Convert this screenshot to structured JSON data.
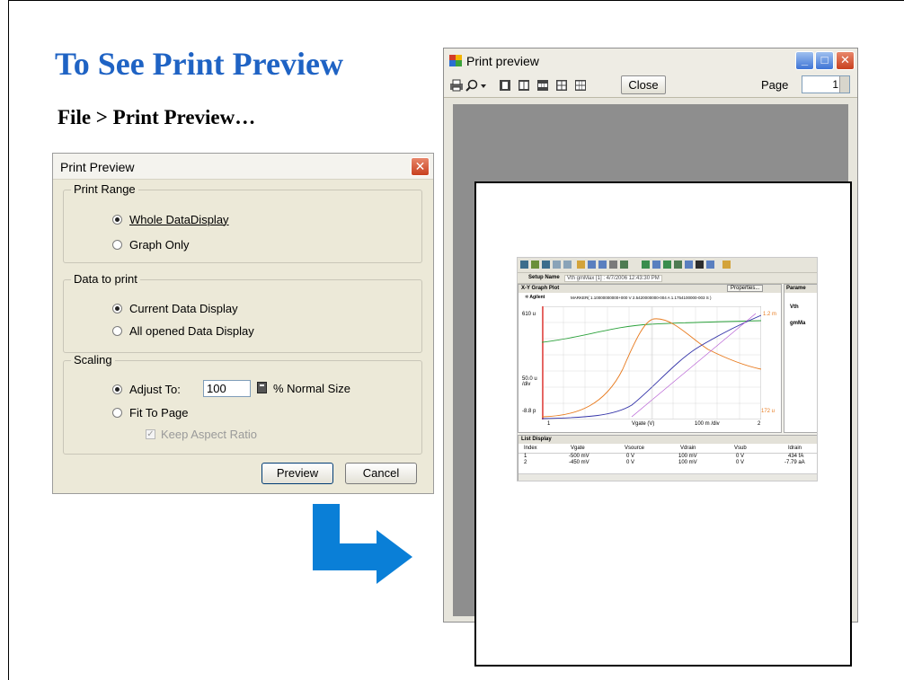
{
  "slide": {
    "title": "To See Print Preview",
    "subtitle": "File > Print Preview…"
  },
  "dialog": {
    "title": "Print Preview",
    "print_range": {
      "legend": "Print Range",
      "options": [
        "Whole DataDisplay",
        "Graph Only"
      ],
      "selected": "Whole DataDisplay"
    },
    "data_to_print": {
      "legend": "Data to print",
      "options": [
        "Current Data Display",
        "All opened Data Display"
      ],
      "selected": "Current Data Display"
    },
    "scaling": {
      "legend": "Scaling",
      "adjust_label": "Adjust To:",
      "adjust_value": "100",
      "percent_label": "% Normal Size",
      "fit_label": "Fit To Page",
      "keep_aspect_label": "Keep Aspect Ratio",
      "selected": "Adjust To:"
    },
    "preview_button": "Preview",
    "cancel_button": "Cancel"
  },
  "preview_window": {
    "title": "Print preview",
    "close_label": "Close",
    "page_label": "Page",
    "page_value": "1",
    "embedded": {
      "setup_tab": "Setup Name",
      "setup_value": "Vth gmMax [1] : 4/7/2006 12:43:30 PM",
      "graph_title": "X-Y Graph Plot",
      "properties_btn": "Properties...",
      "param_title": "Parame",
      "param_vth": "Vth",
      "param_gm": "gmMa",
      "marker_text": "MARKER( 1.10000000000+000 V  2.5420000000-004 A  1.1754100000-003 S )",
      "x_axis_label": "Vgate  (V)",
      "x_div": "100 m /div",
      "x_start": "1",
      "x_end": "2",
      "y_top": "610 u",
      "y_mid": "50.0 u\n/div",
      "y_bottom": "-8.8 p",
      "y2_top": "1.2 m",
      "y2_bottom": "-172 u",
      "list_title": "List Display",
      "list_headers": [
        "Index",
        "Vgate",
        "Vsource",
        "Vdrain",
        "Vsub",
        "Idrain"
      ],
      "list_rows": [
        [
          "1",
          "-500 mV",
          "0 V",
          "100 mV",
          "0 V",
          "434 fA"
        ],
        [
          "2",
          "-450 mV",
          "0 V",
          "100 mV",
          "0 V",
          "-7.79 aA"
        ]
      ]
    }
  },
  "colors": {
    "title_blue": "#1f63c4",
    "arrow_blue": "#0a7fd7",
    "curve_orange": "#e87a1d",
    "curve_green": "#2aa13a",
    "curve_blue": "#3232a8"
  }
}
